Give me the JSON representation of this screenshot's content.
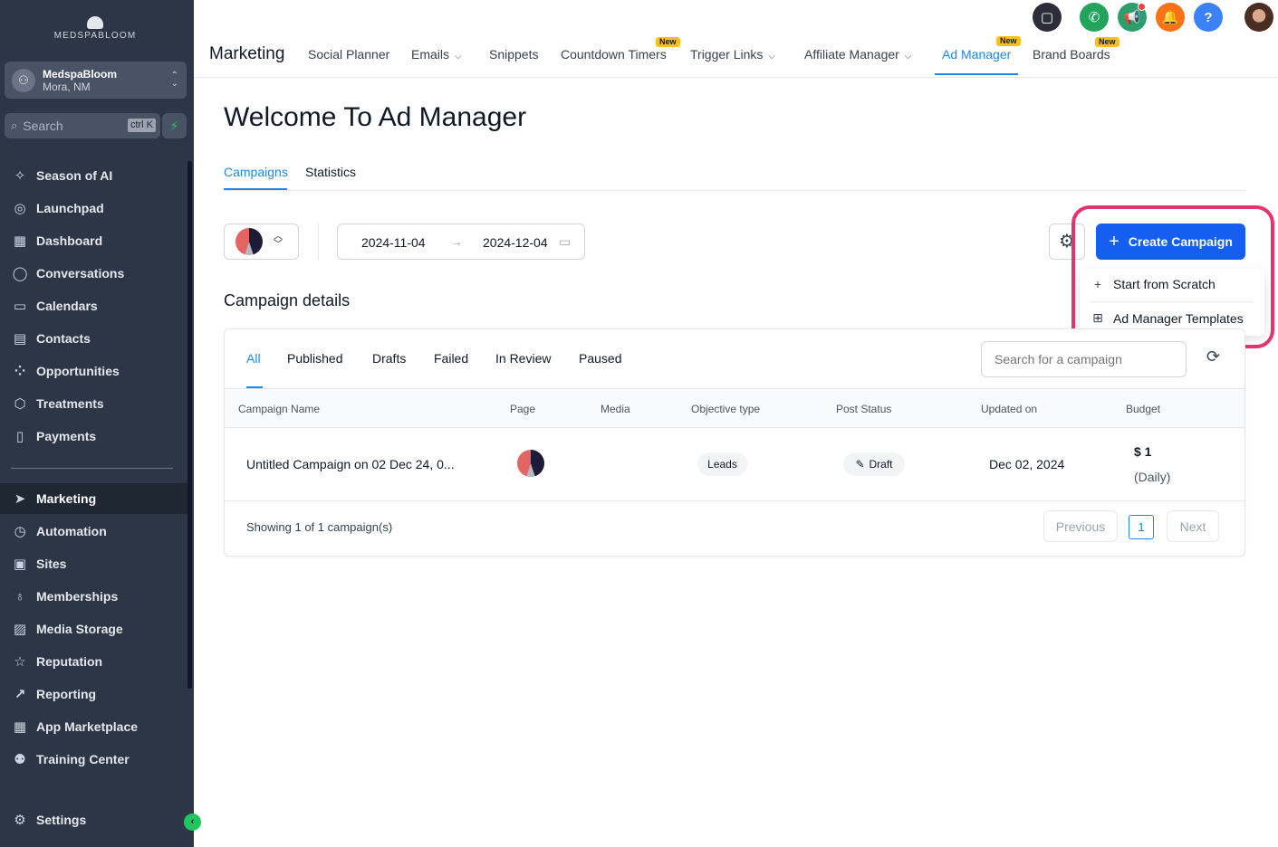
{
  "sidebar": {
    "logo_text": "MEDSPABLOOM",
    "account": {
      "name": "MedspaBloom",
      "location": "Mora, NM"
    },
    "search": {
      "placeholder": "Search",
      "shortcut": "ctrl K"
    },
    "items": [
      {
        "label": "Season of AI",
        "icon": "sparkle-icon"
      },
      {
        "label": "Launchpad",
        "icon": "rocket-icon"
      },
      {
        "label": "Dashboard",
        "icon": "grid-icon"
      },
      {
        "label": "Conversations",
        "icon": "chat-icon"
      },
      {
        "label": "Calendars",
        "icon": "calendar-icon"
      },
      {
        "label": "Contacts",
        "icon": "contacts-icon"
      },
      {
        "label": "Opportunities",
        "icon": "opportunities-icon"
      },
      {
        "label": "Treatments",
        "icon": "box-icon"
      },
      {
        "label": "Payments",
        "icon": "receipt-icon"
      },
      {
        "label": "Marketing",
        "icon": "send-icon",
        "active": true
      },
      {
        "label": "Automation",
        "icon": "automation-icon"
      },
      {
        "label": "Sites",
        "icon": "sites-icon"
      },
      {
        "label": "Memberships",
        "icon": "award-icon"
      },
      {
        "label": "Media Storage",
        "icon": "image-icon"
      },
      {
        "label": "Reputation",
        "icon": "star-icon"
      },
      {
        "label": "Reporting",
        "icon": "trend-icon"
      },
      {
        "label": "App Marketplace",
        "icon": "apps-icon"
      },
      {
        "label": "Training Center",
        "icon": "training-icon"
      }
    ],
    "settings_label": "Settings"
  },
  "header": {
    "title": "Marketing",
    "nav": [
      {
        "label": "Social Planner"
      },
      {
        "label": "Emails",
        "dropdown": true
      },
      {
        "label": "Snippets"
      },
      {
        "label": "Countdown Timers",
        "badge": "New"
      },
      {
        "label": "Trigger Links",
        "dropdown": true
      },
      {
        "label": "Affiliate Manager",
        "dropdown": true
      },
      {
        "label": "Ad Manager",
        "badge": "New",
        "active": true
      },
      {
        "label": "Brand Boards",
        "badge": "New"
      }
    ],
    "icons": [
      {
        "name": "chat-bubble-icon",
        "color": "#2d2d3a"
      },
      {
        "name": "phone-icon",
        "color": "#22a45d"
      },
      {
        "name": "megaphone-icon",
        "color": "#2e9d6e"
      },
      {
        "name": "bell-icon",
        "color": "#f97316"
      },
      {
        "name": "help-icon",
        "color": "#3b82f6",
        "glyph": "?"
      }
    ]
  },
  "main": {
    "title": "Welcome To Ad Manager",
    "tabs": [
      {
        "label": "Campaigns",
        "active": true
      },
      {
        "label": "Statistics"
      }
    ],
    "date_from": "2024-11-04",
    "date_to": "2024-12-04",
    "create_button": "Create Campaign",
    "create_menu": [
      {
        "label": "Start from Scratch",
        "icon": "plus-icon"
      },
      {
        "label": "Ad Manager Templates",
        "icon": "template-icon"
      }
    ],
    "section_title": "Campaign details",
    "filter_tabs": [
      "All",
      "Published",
      "Drafts",
      "Failed",
      "In Review",
      "Paused"
    ],
    "search_placeholder": "Search for a campaign",
    "table": {
      "headers": [
        "Campaign Name",
        "Page",
        "Media",
        "Objective type",
        "Post Status",
        "Updated on",
        "Budget"
      ],
      "rows": [
        {
          "name": "Untitled Campaign on 02 Dec 24, 0...",
          "objective": "Leads",
          "status": "Draft",
          "updated": "Dec 02, 2024",
          "budget": "$ 1",
          "budget_period": "(Daily)"
        }
      ]
    },
    "showing_text": "Showing 1 of 1 campaign(s)",
    "pagination": {
      "previous": "Previous",
      "page": "1",
      "next": "Next"
    }
  },
  "colors": {
    "accent": "#155eef",
    "link": "#1e88e5",
    "highlight": "#e5336f",
    "sidebar_bg": "#2c3646"
  }
}
